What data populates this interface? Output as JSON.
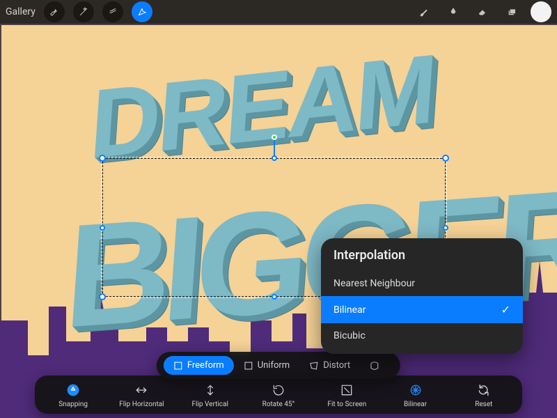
{
  "accent": "#0a7dff",
  "header": {
    "gallery": "Gallery",
    "tools": {
      "wrench": "wrench-icon",
      "adjust": "wand-icon",
      "select": "s-icon",
      "transform": "arrow-icon"
    }
  },
  "artwork": {
    "line1": "DREAM",
    "line2": "BIGGER"
  },
  "mode_bar": {
    "freeform": "Freeform",
    "uniform": "Uniform",
    "distort": "Distort",
    "warp_partial": ""
  },
  "actions": {
    "snapping": "Snapping",
    "fliph": "Flip Horizontal",
    "flipv": "Flip Vertical",
    "rotate": "Rotate 45°",
    "fit": "Fit to Screen",
    "interp": "Bilinear",
    "reset": "Reset"
  },
  "popover": {
    "title": "Interpolation",
    "items": {
      "nearest": "Nearest Neighbour",
      "bilinear": "Bilinear",
      "bicubic": "Bicubic"
    },
    "selected": "bilinear"
  }
}
